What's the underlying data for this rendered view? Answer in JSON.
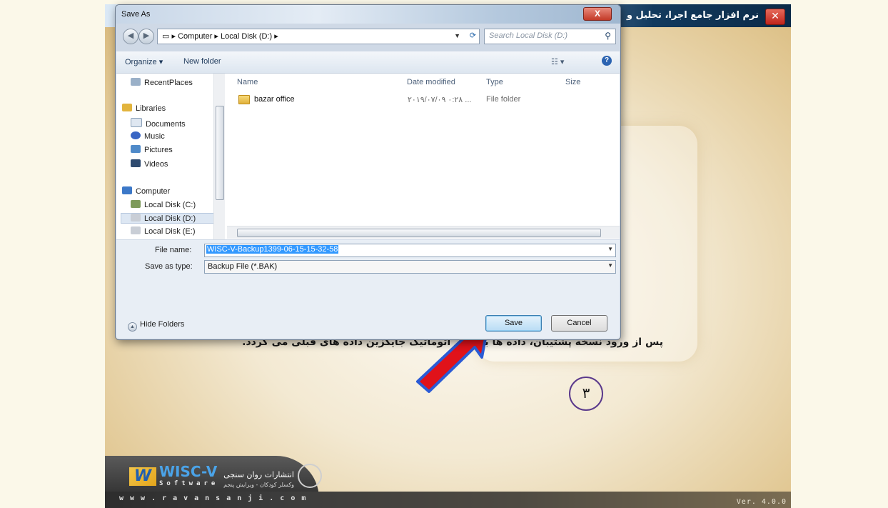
{
  "app": {
    "title": "نرم افزار جامع اجرا، تحلیل و",
    "close": "✕",
    "caption": "پس از ورود نسخه پشتیبان، داده ها به طور اتوماتیک جایگزین داده های قبلی می گردد.",
    "step_number": "۳",
    "logo_name": "WISC-V",
    "logo_sub": "Software",
    "publisher": "انتشارات روان سنجی",
    "publisher_sub": "وکسلر کودکان - ویرایش پنجم",
    "website": "www.ravansanji.com",
    "version": "Ver. 4.0.0",
    "arrow_color": "#e0121a",
    "icons": [
      "close-icon",
      "arrow-icon",
      "logo-icon",
      "emblem-icon"
    ]
  },
  "dialog": {
    "title": "Save As",
    "close": "X",
    "breadcrumb": [
      "Computer",
      "Local Disk (D:)"
    ],
    "search_placeholder": "Search Local Disk (D:)",
    "toolbar": {
      "organize": "Organize ▾",
      "new_folder": "New folder"
    },
    "nav_items": [
      {
        "label": "RecentPlaces",
        "icon": "recent-places-icon"
      },
      {
        "label": "Libraries",
        "icon": "libraries-icon"
      },
      {
        "label": "Documents",
        "icon": "documents-icon"
      },
      {
        "label": "Music",
        "icon": "music-icon"
      },
      {
        "label": "Pictures",
        "icon": "pictures-icon"
      },
      {
        "label": "Videos",
        "icon": "videos-icon"
      },
      {
        "label": "Computer",
        "icon": "computer-icon"
      },
      {
        "label": "Local Disk (C:)",
        "icon": "drive-icon"
      },
      {
        "label": "Local Disk (D:)",
        "icon": "drive-icon",
        "selected": true
      },
      {
        "label": "Local Disk (E:)",
        "icon": "drive-icon"
      }
    ],
    "columns": [
      "Name",
      "Date modified",
      "Type",
      "Size"
    ],
    "files": [
      {
        "name": "bazar office",
        "date": "۲۰۱۹/۰۷/۰۹ ۰:۲۸ ...",
        "type": "File folder",
        "size": ""
      }
    ],
    "file_name_label": "File name:",
    "file_name_value": "WISC-V-Backup1399-06-15-15-32-58",
    "save_type_label": "Save as type:",
    "save_type_value": "Backup File (*.BAK)",
    "hide_folders": "Hide Folders",
    "save_button": "Save",
    "cancel_button": "Cancel"
  }
}
